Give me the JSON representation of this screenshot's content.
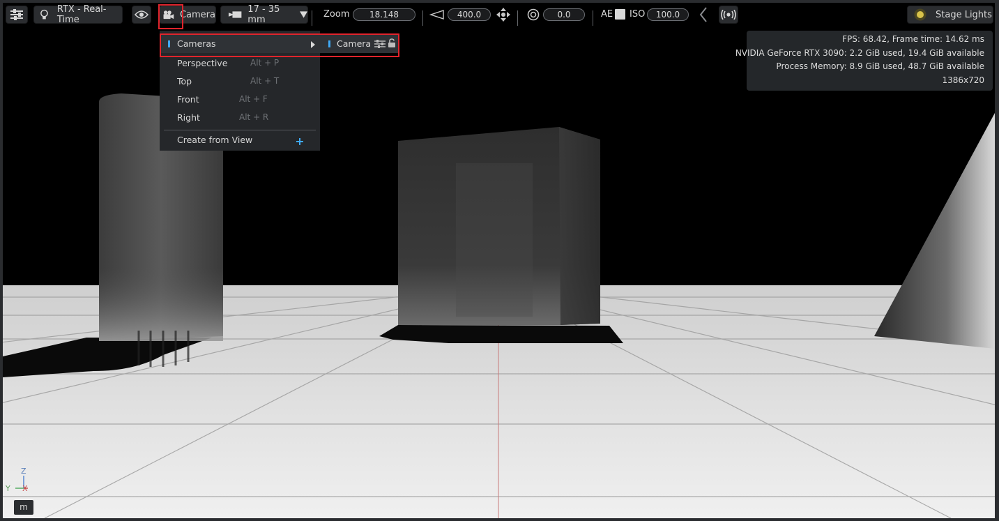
{
  "toolbar": {
    "renderer_label": "RTX - Real-Time",
    "camera_label": "Camera",
    "lens_label": "17 - 35 mm",
    "zoom_label": "Zoom",
    "zoom_value": "18.148",
    "far_value": "400.0",
    "aperture_value": "0.0",
    "ae_label": "AE",
    "iso_label": "ISO",
    "iso_value": "100.0",
    "stage_lights_label": "Stage Lights"
  },
  "camera_menu": {
    "items": [
      {
        "label": "Cameras"
      },
      {
        "label": "Perspective",
        "shortcut": "Alt + P"
      },
      {
        "label": "Top",
        "shortcut": "Alt + T"
      },
      {
        "label": "Front",
        "shortcut": "Alt + F"
      },
      {
        "label": "Right",
        "shortcut": "Alt + R"
      },
      {
        "label": "Create from View"
      }
    ],
    "submenu": {
      "camera_label": "Camera"
    }
  },
  "stats": {
    "fps": "FPS: 68.42, Frame time: 14.62 ms",
    "gpu": "NVIDIA GeForce RTX 3090: 2.2 GiB used, 19.4 GiB available",
    "memory": "Process Memory: 8.9 GiB used, 48.7 GiB available",
    "resolution": "1386x720"
  },
  "axis": {
    "z": "Z",
    "y": "Y",
    "x": "X"
  },
  "units_label": "m",
  "colors": {
    "accent_blue": "#3fa9f5",
    "highlight_red": "#e0242c",
    "menu_bg": "#25272a"
  }
}
